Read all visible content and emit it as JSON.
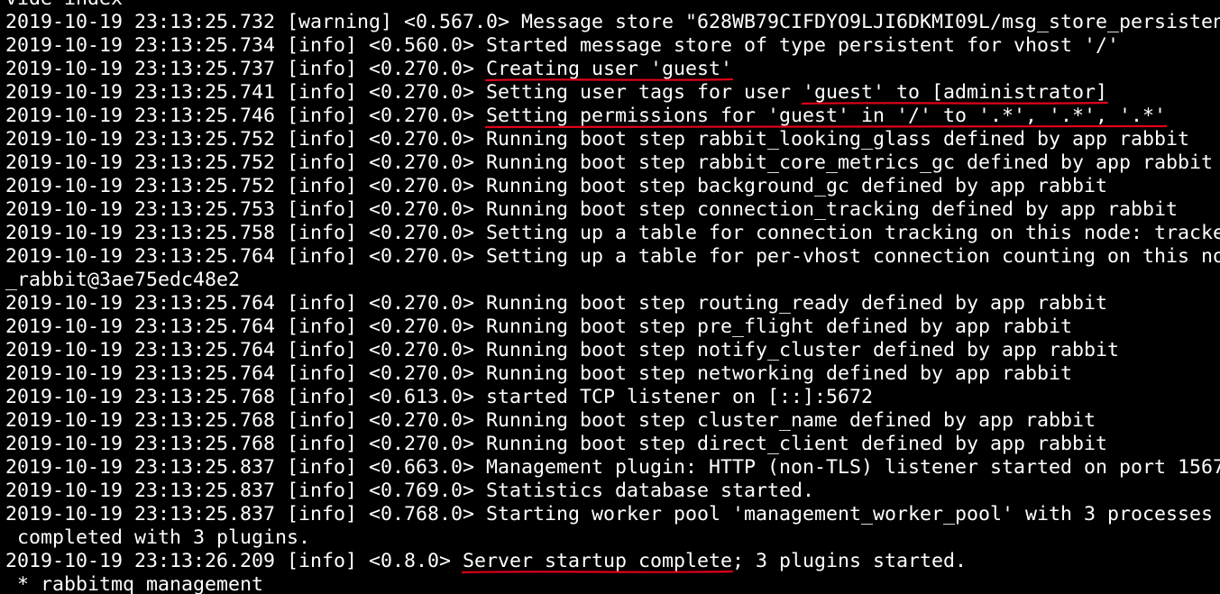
{
  "terminal": {
    "background_color": "#000000",
    "text_color": "#ffffff",
    "annotation_color": "#e0001b",
    "lines": [
      {
        "segments": [
          {
            "text": "vide index"
          }
        ]
      },
      {
        "segments": [
          {
            "text": "2019-10-19 23:13:25.732 [warning] <0.567.0> Message store \"628WB79CIFDYO9LJI6DKMI09L/msg_store_persisten"
          }
        ]
      },
      {
        "segments": [
          {
            "text": "2019-10-19 23:13:25.734 [info] <0.560.0> Started message store of type persistent for vhost '/'"
          }
        ]
      },
      {
        "segments": [
          {
            "text": "2019-10-19 23:13:25.737 [info] <0.270.0> "
          },
          {
            "text": "Creating user 'guest'",
            "highlight": true
          }
        ]
      },
      {
        "segments": [
          {
            "text": "2019-10-19 23:13:25.741 [info] <0.270.0> Setting user tags for user "
          },
          {
            "text": "'guest' to [administrator]",
            "highlight": true
          }
        ]
      },
      {
        "segments": [
          {
            "text": "2019-10-19 23:13:25.746 [info] <0.270.0> "
          },
          {
            "text": "Setting permissions for 'guest' in '/' to '.*', '.*', '.*'",
            "highlight": true
          }
        ]
      },
      {
        "segments": [
          {
            "text": "2019-10-19 23:13:25.752 [info] <0.270.0> Running boot step rabbit_looking_glass defined by app rabbit"
          }
        ]
      },
      {
        "segments": [
          {
            "text": "2019-10-19 23:13:25.752 [info] <0.270.0> Running boot step rabbit_core_metrics_gc defined by app rabbit"
          }
        ]
      },
      {
        "segments": [
          {
            "text": "2019-10-19 23:13:25.752 [info] <0.270.0> Running boot step background_gc defined by app rabbit"
          }
        ]
      },
      {
        "segments": [
          {
            "text": "2019-10-19 23:13:25.753 [info] <0.270.0> Running boot step connection_tracking defined by app rabbit"
          }
        ]
      },
      {
        "segments": [
          {
            "text": "2019-10-19 23:13:25.758 [info] <0.270.0> Setting up a table for connection tracking on this node: tracke"
          }
        ]
      },
      {
        "segments": [
          {
            "text": "2019-10-19 23:13:25.764 [info] <0.270.0> Setting up a table for per-vhost connection counting on this no"
          }
        ]
      },
      {
        "segments": [
          {
            "text": "_rabbit@3ae75edc48e2"
          }
        ]
      },
      {
        "segments": [
          {
            "text": "2019-10-19 23:13:25.764 [info] <0.270.0> Running boot step routing_ready defined by app rabbit"
          }
        ]
      },
      {
        "segments": [
          {
            "text": "2019-10-19 23:13:25.764 [info] <0.270.0> Running boot step pre_flight defined by app rabbit"
          }
        ]
      },
      {
        "segments": [
          {
            "text": "2019-10-19 23:13:25.764 [info] <0.270.0> Running boot step notify_cluster defined by app rabbit"
          }
        ]
      },
      {
        "segments": [
          {
            "text": "2019-10-19 23:13:25.764 [info] <0.270.0> Running boot step networking defined by app rabbit"
          }
        ]
      },
      {
        "segments": [
          {
            "text": "2019-10-19 23:13:25.768 [info] <0.613.0> started TCP listener on [::]:5672"
          }
        ]
      },
      {
        "segments": [
          {
            "text": "2019-10-19 23:13:25.768 [info] <0.270.0> Running boot step cluster_name defined by app rabbit"
          }
        ]
      },
      {
        "segments": [
          {
            "text": "2019-10-19 23:13:25.768 [info] <0.270.0> Running boot step direct_client defined by app rabbit"
          }
        ]
      },
      {
        "segments": [
          {
            "text": "2019-10-19 23:13:25.837 [info] <0.663.0> Management plugin: HTTP (non-TLS) listener started on port 1567"
          }
        ]
      },
      {
        "segments": [
          {
            "text": "2019-10-19 23:13:25.837 [info] <0.769.0> Statistics database started."
          }
        ]
      },
      {
        "segments": [
          {
            "text": "2019-10-19 23:13:25.837 [info] <0.768.0> Starting worker pool 'management_worker_pool' with 3 processes"
          }
        ]
      },
      {
        "segments": [
          {
            "text": " completed with 3 plugins."
          }
        ]
      },
      {
        "segments": [
          {
            "text": "2019-10-19 23:13:26.209 [info] <0.8.0> "
          },
          {
            "text": "Server startup complete",
            "highlight": true
          },
          {
            "text": "; 3 plugins started."
          }
        ]
      },
      {
        "segments": [
          {
            "text": " * rabbitmq_management"
          }
        ]
      }
    ]
  }
}
